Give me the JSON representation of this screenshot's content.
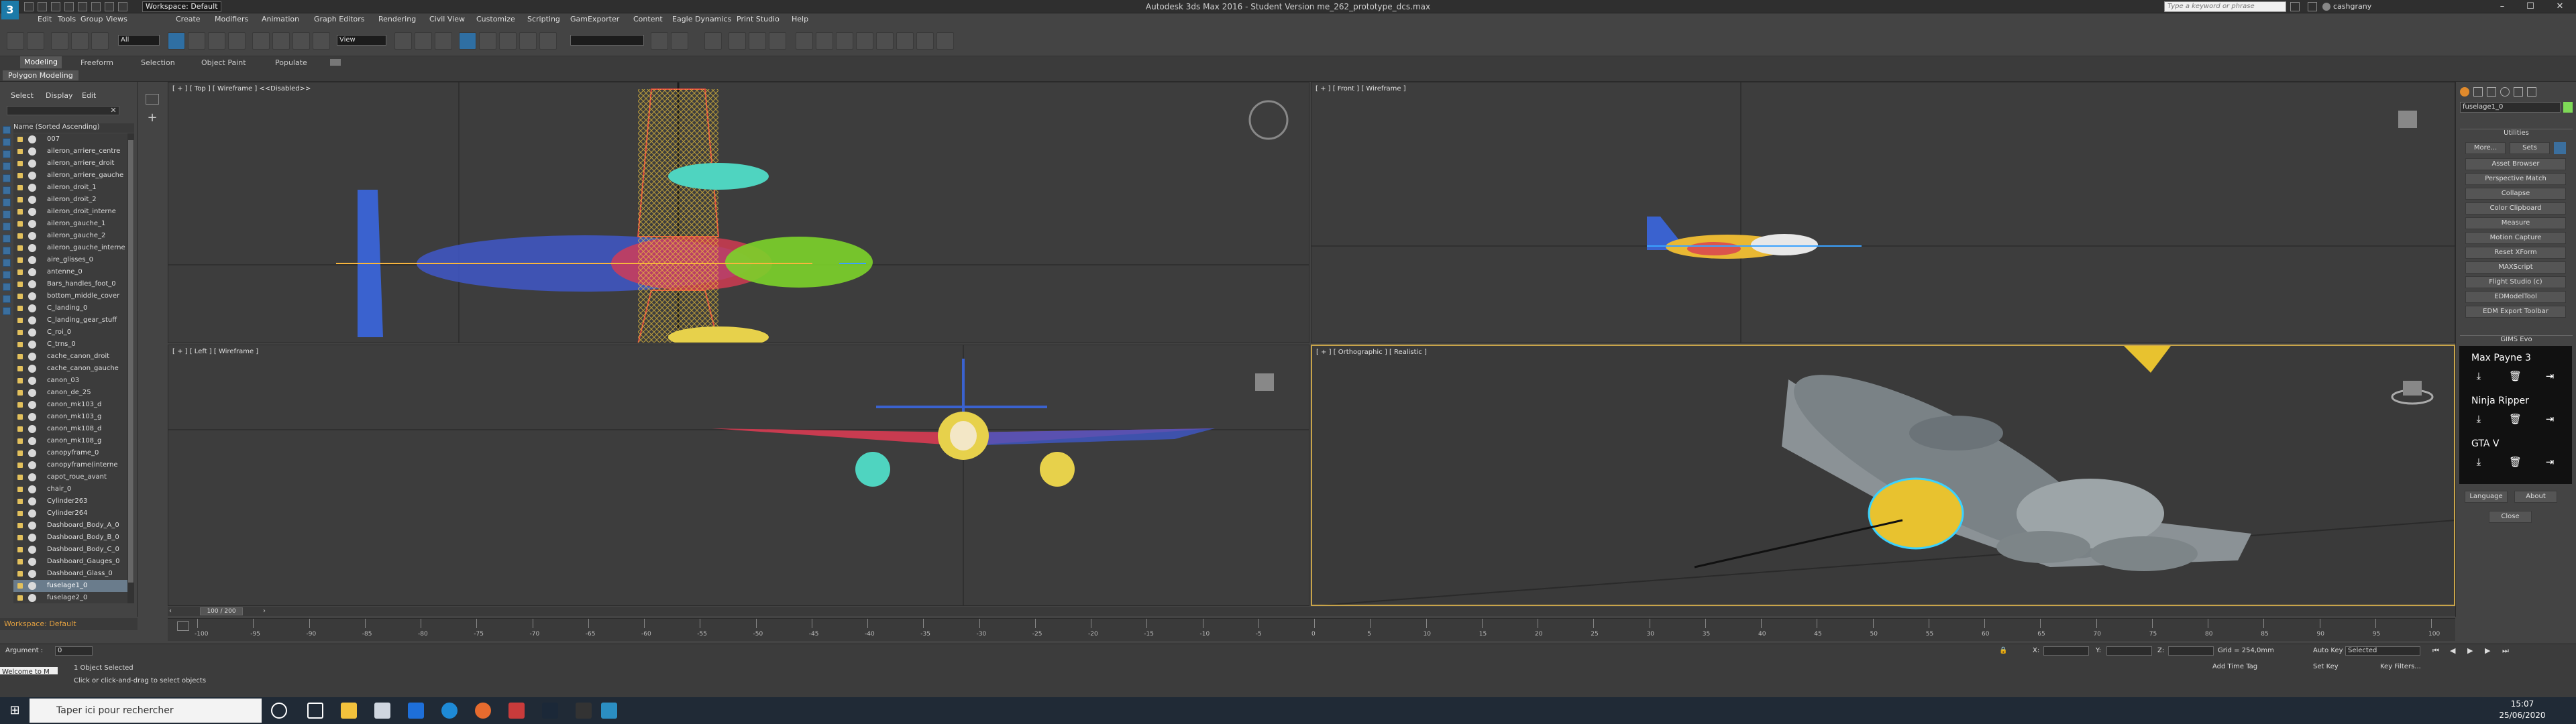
{
  "titlebar": {
    "title": "Autodesk 3ds Max 2016 - Student Version   me_262_prototype_dcs.max",
    "workspace": "Workspace: Default",
    "search_placeholder": "Type a keyword or phrase",
    "user": "cashgrany",
    "min": "–",
    "max": "☐",
    "close": "✕"
  },
  "menu": [
    "Edit",
    "Tools",
    "Group",
    "Views",
    "Create",
    "Modifiers",
    "Animation",
    "Graph Editors",
    "Rendering",
    "Civil View",
    "Customize",
    "Scripting",
    "GamExporter",
    "Content",
    "Eagle Dynamics",
    "Print Studio",
    "Help"
  ],
  "toolbar": {
    "selection_filter": "All",
    "ref_coord": "View"
  },
  "ribbon": {
    "tabs": [
      "Modeling",
      "Freeform",
      "Selection",
      "Object Paint",
      "Populate"
    ],
    "subtab": "Polygon Modeling"
  },
  "explorer": {
    "tabs": [
      "Select",
      "Display",
      "Edit"
    ],
    "header": "Name (Sorted Ascending)",
    "items": [
      "007",
      "aileron_arriere_centre",
      "aileron_arriere_droit",
      "aileron_arriere_gauche",
      "aileron_droit_1",
      "aileron_droit_2",
      "aileron_droit_interne",
      "aileron_gauche_1",
      "aileron_gauche_2",
      "aileron_gauche_interne",
      "aire_glisses_0",
      "antenne_0",
      "Bars_handles_foot_0",
      "bottom_middle_cover",
      "C_landing_0",
      "C_landing_gear_stuff",
      "C_roi_0",
      "C_trns_0",
      "cache_canon_droit",
      "cache_canon_gauche",
      "canon_03",
      "canon_de_25",
      "canon_mk103_d",
      "canon_mk103_g",
      "canon_mk108_d",
      "canon_mk108_g",
      "canopyframe_0",
      "canopyframe(interne",
      "capot_roue_avant",
      "chair_0",
      "Cylinder263",
      "Cylinder264",
      "Dashboard_Body_A_0",
      "Dashboard_Body_B_0",
      "Dashboard_Body_C_0",
      "Dashboard_Gauges_0",
      "Dashboard_Glass_0",
      "fuselage1_0",
      "fuselage2_0"
    ],
    "selected_index": 37,
    "workspace": "Workspace: Default"
  },
  "viewports": {
    "top": "[ + ] [ Top ] [ Wireframe ]   <<Disabled>>",
    "front": "[ + ] [ Front ] [ Wireframe ]",
    "left": "[ + ] [ Left ] [ Wireframe ]",
    "persp": "[ + ] [ Orthographic ] [ Realistic ]"
  },
  "command": {
    "object_name": "fuselage1_0",
    "utilities_title": "Utilities",
    "more": "More...",
    "sets": "Sets",
    "buttons": [
      "Asset Browser",
      "Perspective Match",
      "Collapse",
      "Color Clipboard",
      "Measure",
      "Motion Capture",
      "Reset XForm",
      "MAXScript",
      "Flight Studio (c)",
      "EDModelTool",
      "EDM Export Toolbar"
    ],
    "gims_title": "GIMS Evo",
    "gims_games": [
      "Max Payne 3",
      "Ninja Ripper",
      "GTA V"
    ],
    "language": "Language",
    "about": "About",
    "close": "Close"
  },
  "timeline": {
    "frame": "100 / 200",
    "ticks": [
      "-100",
      "-95",
      "-90",
      "-85",
      "-80",
      "-75",
      "-70",
      "-65",
      "-60",
      "-55",
      "-50",
      "-45",
      "-40",
      "-35",
      "-30",
      "-25",
      "-20",
      "-15",
      "-10",
      "-5",
      "0",
      "5",
      "10",
      "15",
      "20",
      "25",
      "30",
      "35",
      "40",
      "45",
      "50",
      "55",
      "60",
      "65",
      "70",
      "75",
      "80",
      "85",
      "90",
      "95",
      "100"
    ]
  },
  "status": {
    "argument_label": "Argument :",
    "argument_value": "0",
    "objects_selected": "1 Object Selected",
    "hint": "Click or click-and-drag to select objects",
    "welcome": "Welcome to M",
    "grid": "Grid = 254,0mm",
    "auto_key": "Auto Key",
    "selected": "Selected",
    "set_key": "Set Key",
    "key_filters": "Key Filters...",
    "add_time_tag": "Add Time Tag",
    "x": "X:",
    "y": "Y:",
    "z": "Z:"
  },
  "taskbar": {
    "search": "Taper ici pour rechercher",
    "time": "15:07",
    "date": "25/06/2020"
  }
}
